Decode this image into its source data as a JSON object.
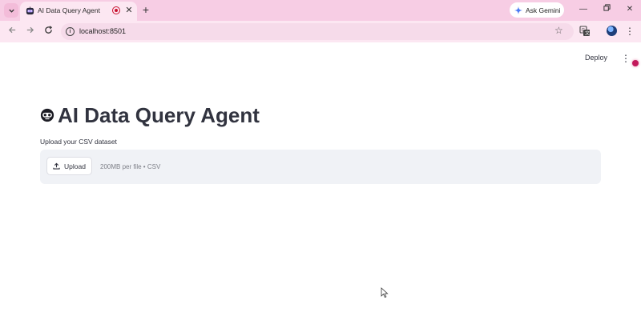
{
  "browser": {
    "tab": {
      "title": "AI Data Query Agent"
    },
    "new_tab_symbol": "+",
    "gemini_label": "Ask Gemini",
    "url": "localhost:8501"
  },
  "app": {
    "deploy_label": "Deploy",
    "title": "AI Data Query Agent",
    "uploader": {
      "label": "Upload your CSV dataset",
      "button_label": "Upload",
      "limit_text": "200MB per file • CSV"
    }
  },
  "colors": {
    "tab_strip": "#f7cde4",
    "toolbar": "#fce7f2",
    "dropzone": "#f0f2f6",
    "text": "#31333f",
    "status_dot": "#c2185b"
  },
  "icons": {
    "tab_search": "chevron-down-icon",
    "favicon": "robot-face-icon",
    "recording": "record-icon",
    "close": "close-icon",
    "gemini": "sparkle-icon",
    "back": "arrow-left-icon",
    "forward": "arrow-right-icon",
    "reload": "reload-icon",
    "site_info": "info-icon",
    "bookmark": "star-icon",
    "translate": "translate-icon",
    "profile": "avatar-icon",
    "menu": "kebab-icon",
    "upload": "upload-icon",
    "title_emoji": "robot-face-icon",
    "cursor": "mouse-pointer-icon"
  }
}
